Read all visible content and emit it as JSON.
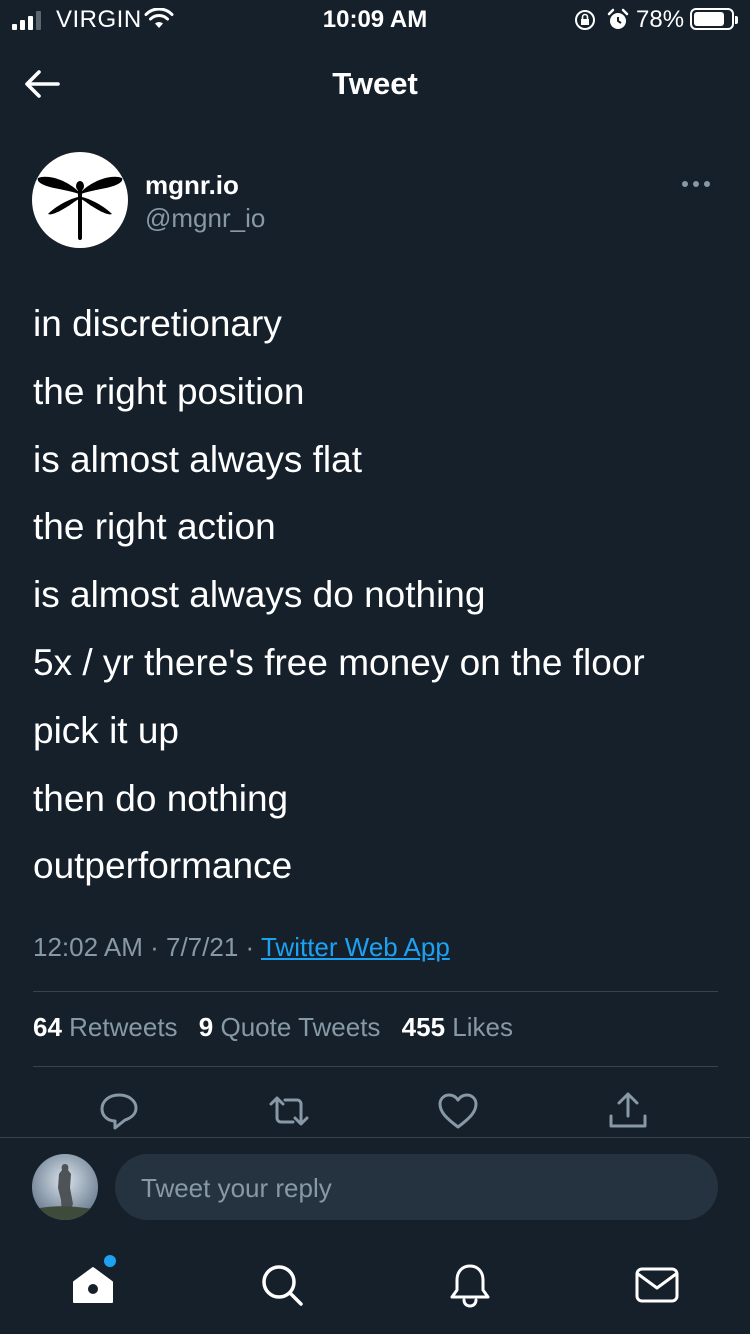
{
  "status_bar": {
    "carrier": "VIRGIN",
    "time": "10:09 AM",
    "battery_percent": "78%",
    "battery_level": 0.78,
    "signal_bars": 3
  },
  "header": {
    "title": "Tweet",
    "back_icon": "arrow-left-icon"
  },
  "tweet": {
    "author_name": "mgnr.io",
    "author_handle": "@mgnr_io",
    "lines": [
      "in discretionary",
      "the right position",
      "is almost always flat",
      "the right action",
      "is almost always do nothing",
      "5x / yr there's free money on the floor",
      "pick it up",
      "then do nothing",
      "outperformance"
    ],
    "time": "12:02 AM",
    "date": "7/7/21",
    "source": "Twitter Web App",
    "separator": "·",
    "stats": {
      "retweets_count": "64",
      "retweets_label": "Retweets",
      "quotes_count": "9",
      "quotes_label": "Quote Tweets",
      "likes_count": "455",
      "likes_label": "Likes"
    }
  },
  "actions": [
    "reply-icon",
    "retweet-icon",
    "like-icon",
    "share-icon"
  ],
  "reply": {
    "placeholder": "Tweet your reply"
  },
  "tab_bar": [
    "home-icon",
    "search-icon",
    "notifications-icon",
    "messages-icon"
  ],
  "colors": {
    "background": "#15202b",
    "text": "#ffffff",
    "secondary": "#8899a6",
    "accent": "#1da1f2",
    "divider": "#38444d",
    "input_bg": "#253341"
  }
}
